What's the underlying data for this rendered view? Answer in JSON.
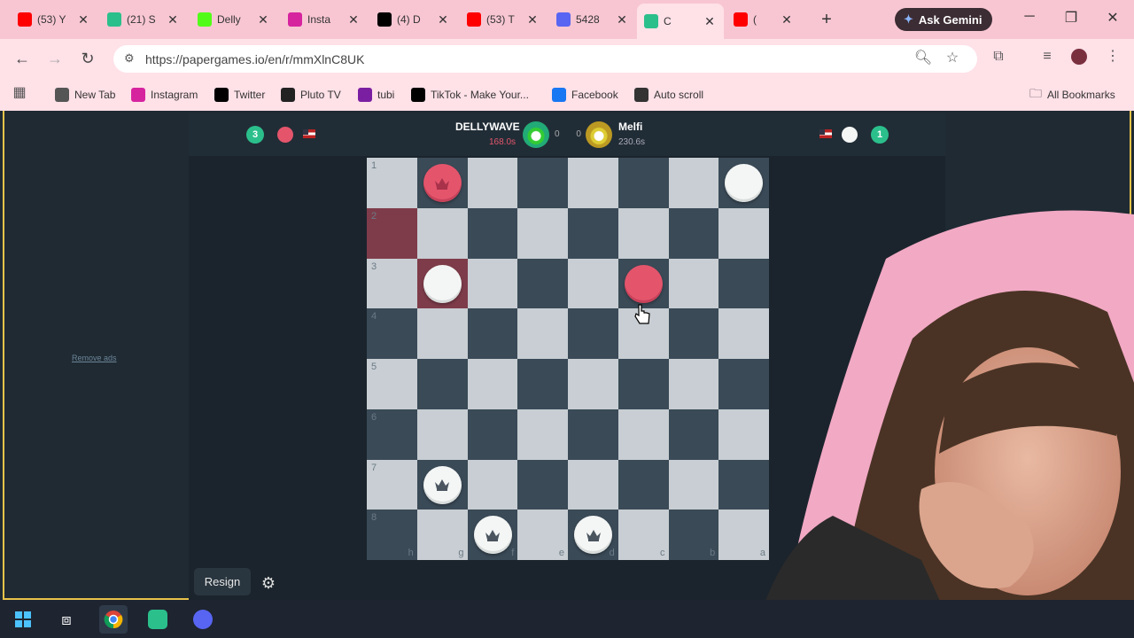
{
  "browser": {
    "tabs": [
      {
        "title": "(53) Y",
        "icon": "youtube-icon",
        "color": "#ff0000"
      },
      {
        "title": "(21) S",
        "icon": "app-icon",
        "color": "#2bbf8c"
      },
      {
        "title": "Delly",
        "icon": "kick-icon",
        "color": "#53fc18"
      },
      {
        "title": "Insta",
        "icon": "instagram-icon",
        "color": "#d6249f"
      },
      {
        "title": "(4) D",
        "icon": "x-icon",
        "color": "#000000"
      },
      {
        "title": "(53) T",
        "icon": "youtube-icon",
        "color": "#ff0000"
      },
      {
        "title": "5428",
        "icon": "discord-icon",
        "color": "#5865f2"
      },
      {
        "title": "C",
        "icon": "papergames-icon",
        "color": "#2bbf8c"
      },
      {
        "title": "(",
        "icon": "youtube-icon",
        "color": "#ff0000"
      }
    ],
    "gemini_label": "Ask Gemini",
    "url": "https://papergames.io/en/r/mmXlnC8UK",
    "bookmarks": [
      {
        "label": "New Tab",
        "icon": "chrome-icon"
      },
      {
        "label": "Instagram",
        "icon": "instagram-icon"
      },
      {
        "label": "Twitter",
        "icon": "x-icon"
      },
      {
        "label": "Pluto TV",
        "icon": "plutotv-icon"
      },
      {
        "label": "tubi",
        "icon": "tubi-icon"
      },
      {
        "label": "TikTok - Make Your...",
        "icon": "tiktok-icon"
      },
      {
        "label": "Facebook",
        "icon": "facebook-icon"
      },
      {
        "label": "Auto scroll",
        "icon": "autoscroll-icon"
      }
    ],
    "all_bookmarks": "All Bookmarks"
  },
  "page": {
    "remove_ads": "Remove ads",
    "resign": "Resign"
  },
  "players": {
    "left": {
      "name": "DELLYWAVE",
      "time": "168.0s",
      "count": "3",
      "color": "#e4556c"
    },
    "right": {
      "name": "Melfi",
      "time": "230.6s",
      "count": "1",
      "color": "#f4f6f5"
    },
    "score": "0 0"
  },
  "board": {
    "ranks": [
      "1",
      "2",
      "3",
      "4",
      "5",
      "6",
      "7",
      "8"
    ],
    "files": [
      "h",
      "g",
      "f",
      "e",
      "d",
      "c",
      "b",
      "a"
    ],
    "pieces": [
      {
        "row": 0,
        "col": 1,
        "color": "red",
        "king": true
      },
      {
        "row": 0,
        "col": 7,
        "color": "white",
        "king": false
      },
      {
        "row": 2,
        "col": 1,
        "color": "white",
        "king": false
      },
      {
        "row": 2,
        "col": 5,
        "color": "red",
        "king": false
      },
      {
        "row": 6,
        "col": 1,
        "color": "white",
        "king": true
      },
      {
        "row": 7,
        "col": 2,
        "color": "white",
        "king": true
      },
      {
        "row": 7,
        "col": 4,
        "color": "white",
        "king": true
      }
    ],
    "highlights": [
      {
        "row": 1,
        "col": 0
      },
      {
        "row": 2,
        "col": 1
      }
    ]
  }
}
